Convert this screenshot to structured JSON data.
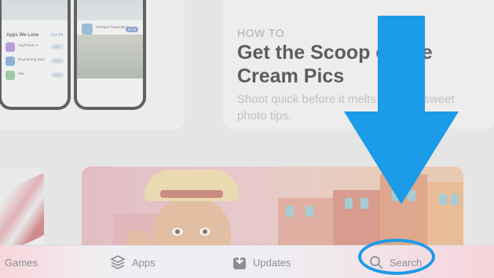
{
  "phones": {
    "left": {
      "section_title": "Apps We Love",
      "see_all": "See All",
      "rows": [
        {
          "name": "AnyPicture 3",
          "button": "GET",
          "icon_color": "#a980d8"
        },
        {
          "name": "Boomerang (Six)",
          "button": "GET",
          "icon_color": "#6aa0d8"
        },
        {
          "name": "Klia",
          "button": "GET",
          "icon_color": "#85c493"
        }
      ]
    },
    "right": {
      "app_title": "AirPlane Travel Book",
      "price": "$1.99"
    }
  },
  "howto": {
    "label": "HOW TO",
    "title": "Get the Scoop on Ice Cream Pics",
    "subtitle": "Shoot quick before it melts with our sweet photo tips."
  },
  "tabbar": {
    "games": "Games",
    "apps": "Apps",
    "updates": "Updates",
    "search": "Search"
  },
  "colors": {
    "annotation_blue": "#1b9be8",
    "tab_inactive": "#8e8e93"
  }
}
